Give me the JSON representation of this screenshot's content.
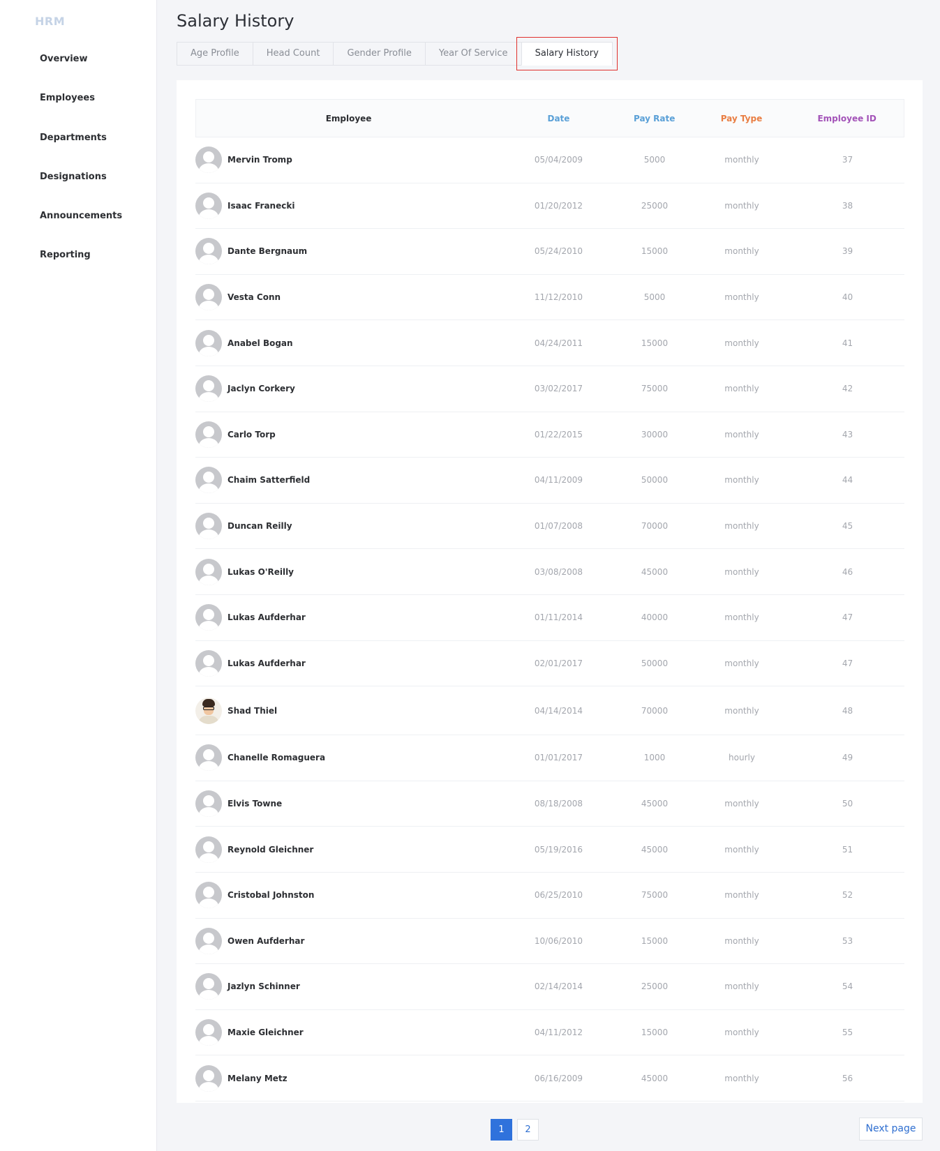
{
  "sidebar": {
    "brand": "HRM",
    "items": [
      {
        "label": "Overview"
      },
      {
        "label": "Employees"
      },
      {
        "label": "Departments"
      },
      {
        "label": "Designations"
      },
      {
        "label": "Announcements"
      },
      {
        "label": "Reporting"
      }
    ]
  },
  "header": {
    "title": "Salary History"
  },
  "tabs": [
    {
      "label": "Age Profile",
      "active": false
    },
    {
      "label": "Head Count",
      "active": false
    },
    {
      "label": "Gender Profile",
      "active": false
    },
    {
      "label": "Year Of Service",
      "active": false
    },
    {
      "label": "Salary History",
      "active": true
    }
  ],
  "table": {
    "columns": {
      "employee": "Employee",
      "date": "Date",
      "pay_rate": "Pay Rate",
      "pay_type": "Pay Type",
      "employee_id": "Employee ID"
    },
    "column_colors": {
      "date": "#5aa0d7",
      "pay_rate": "#5aa0d7",
      "pay_type": "#e97e43",
      "employee_id": "#a353b8"
    },
    "rows": [
      {
        "name": "Mervin Tromp",
        "date": "05/04/2009",
        "pay_rate": "5000",
        "pay_type": "monthly",
        "id": "37",
        "avatar": "placeholder-avatar-icon"
      },
      {
        "name": "Isaac Franecki",
        "date": "01/20/2012",
        "pay_rate": "25000",
        "pay_type": "monthly",
        "id": "38",
        "avatar": "placeholder-avatar-icon"
      },
      {
        "name": "Dante Bergnaum",
        "date": "05/24/2010",
        "pay_rate": "15000",
        "pay_type": "monthly",
        "id": "39",
        "avatar": "placeholder-avatar-icon"
      },
      {
        "name": "Vesta Conn",
        "date": "11/12/2010",
        "pay_rate": "5000",
        "pay_type": "monthly",
        "id": "40",
        "avatar": "placeholder-avatar-icon"
      },
      {
        "name": "Anabel Bogan",
        "date": "04/24/2011",
        "pay_rate": "15000",
        "pay_type": "monthly",
        "id": "41",
        "avatar": "placeholder-avatar-icon"
      },
      {
        "name": "Jaclyn Corkery",
        "date": "03/02/2017",
        "pay_rate": "75000",
        "pay_type": "monthly",
        "id": "42",
        "avatar": "placeholder-avatar-icon"
      },
      {
        "name": "Carlo Torp",
        "date": "01/22/2015",
        "pay_rate": "30000",
        "pay_type": "monthly",
        "id": "43",
        "avatar": "placeholder-avatar-icon"
      },
      {
        "name": "Chaim Satterfield",
        "date": "04/11/2009",
        "pay_rate": "50000",
        "pay_type": "monthly",
        "id": "44",
        "avatar": "placeholder-avatar-icon"
      },
      {
        "name": "Duncan Reilly",
        "date": "01/07/2008",
        "pay_rate": "70000",
        "pay_type": "monthly",
        "id": "45",
        "avatar": "placeholder-avatar-icon"
      },
      {
        "name": "Lukas O'Reilly",
        "date": "03/08/2008",
        "pay_rate": "45000",
        "pay_type": "monthly",
        "id": "46",
        "avatar": "placeholder-avatar-icon"
      },
      {
        "name": "Lukas Aufderhar",
        "date": "01/11/2014",
        "pay_rate": "40000",
        "pay_type": "monthly",
        "id": "47",
        "avatar": "placeholder-avatar-icon"
      },
      {
        "name": "Lukas Aufderhar",
        "date": "02/01/2017",
        "pay_rate": "50000",
        "pay_type": "monthly",
        "id": "47",
        "avatar": "placeholder-avatar-icon"
      },
      {
        "name": "Shad Thiel",
        "date": "04/14/2014",
        "pay_rate": "70000",
        "pay_type": "monthly",
        "id": "48",
        "avatar": "cartoon-photo-avatar"
      },
      {
        "name": "Chanelle Romaguera",
        "date": "01/01/2017",
        "pay_rate": "1000",
        "pay_type": "hourly",
        "id": "49",
        "avatar": "placeholder-avatar-icon"
      },
      {
        "name": "Elvis Towne",
        "date": "08/18/2008",
        "pay_rate": "45000",
        "pay_type": "monthly",
        "id": "50",
        "avatar": "placeholder-avatar-icon"
      },
      {
        "name": "Reynold Gleichner",
        "date": "05/19/2016",
        "pay_rate": "45000",
        "pay_type": "monthly",
        "id": "51",
        "avatar": "placeholder-avatar-icon"
      },
      {
        "name": "Cristobal Johnston",
        "date": "06/25/2010",
        "pay_rate": "75000",
        "pay_type": "monthly",
        "id": "52",
        "avatar": "placeholder-avatar-icon"
      },
      {
        "name": "Owen Aufderhar",
        "date": "10/06/2010",
        "pay_rate": "15000",
        "pay_type": "monthly",
        "id": "53",
        "avatar": "placeholder-avatar-icon"
      },
      {
        "name": "Jazlyn Schinner",
        "date": "02/14/2014",
        "pay_rate": "25000",
        "pay_type": "monthly",
        "id": "54",
        "avatar": "placeholder-avatar-icon"
      },
      {
        "name": "Maxie Gleichner",
        "date": "04/11/2012",
        "pay_rate": "15000",
        "pay_type": "monthly",
        "id": "55",
        "avatar": "placeholder-avatar-icon"
      },
      {
        "name": "Melany Metz",
        "date": "06/16/2009",
        "pay_rate": "45000",
        "pay_type": "monthly",
        "id": "56",
        "avatar": "placeholder-avatar-icon"
      }
    ]
  },
  "pagination": {
    "pages": [
      "1",
      "2"
    ],
    "current": "1",
    "next_label": "Next page"
  },
  "colors": {
    "accent": "#2f72dc",
    "active_tab_highlight": "#e0302d",
    "brand": "#c5d3e6"
  }
}
